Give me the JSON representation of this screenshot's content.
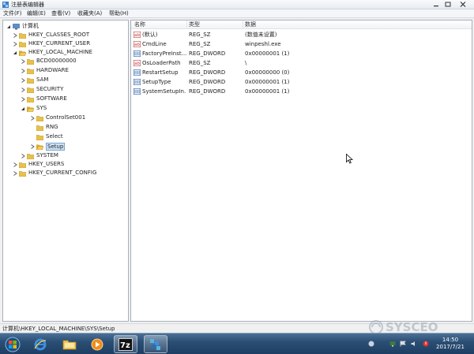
{
  "window": {
    "title": "注册表编辑器",
    "icon": "regedit-icon"
  },
  "menubar": {
    "items": [
      "文件(F)",
      "编辑(E)",
      "查看(V)",
      "收藏夹(A)",
      "帮助(H)"
    ]
  },
  "tree": {
    "root": "计算机",
    "nodes": [
      {
        "label": "HKEY_CLASSES_ROOT",
        "level": 1,
        "expanded": false
      },
      {
        "label": "HKEY_CURRENT_USER",
        "level": 1,
        "expanded": false
      },
      {
        "label": "HKEY_LOCAL_MACHINE",
        "level": 1,
        "expanded": true
      },
      {
        "label": "BCD00000000",
        "level": 2,
        "expanded": false
      },
      {
        "label": "HARDWARE",
        "level": 2,
        "expanded": false
      },
      {
        "label": "SAM",
        "level": 2,
        "expanded": false
      },
      {
        "label": "SECURITY",
        "level": 2,
        "expanded": false
      },
      {
        "label": "SOFTWARE",
        "level": 2,
        "expanded": false
      },
      {
        "label": "SYS",
        "level": 2,
        "expanded": true
      },
      {
        "label": "ControlSet001",
        "level": 3,
        "expanded": false
      },
      {
        "label": "RNG",
        "level": 3,
        "expanded": false,
        "leaf": true
      },
      {
        "label": "Select",
        "level": 3,
        "expanded": false,
        "leaf": true
      },
      {
        "label": "Setup",
        "level": 3,
        "expanded": false,
        "selected": true
      },
      {
        "label": "SYSTEM",
        "level": 2,
        "expanded": false
      },
      {
        "label": "HKEY_USERS",
        "level": 1,
        "expanded": false
      },
      {
        "label": "HKEY_CURRENT_CONFIG",
        "level": 1,
        "expanded": false
      }
    ]
  },
  "list": {
    "columns": [
      "名称",
      "类型",
      "数据"
    ],
    "rows": [
      {
        "name": "(默认)",
        "type": "REG_SZ",
        "data": "(数值未设置)",
        "icon": "string-value-icon"
      },
      {
        "name": "CmdLine",
        "type": "REG_SZ",
        "data": "winpeshl.exe",
        "icon": "string-value-icon"
      },
      {
        "name": "FactoryPreInst...",
        "type": "REG_DWORD",
        "data": "0x00000001 (1)",
        "icon": "binary-value-icon"
      },
      {
        "name": "OsLoaderPath",
        "type": "REG_SZ",
        "data": "\\",
        "icon": "string-value-icon"
      },
      {
        "name": "RestartSetup",
        "type": "REG_DWORD",
        "data": "0x00000000 (0)",
        "icon": "binary-value-icon"
      },
      {
        "name": "SetupType",
        "type": "REG_DWORD",
        "data": "0x00000001 (1)",
        "icon": "binary-value-icon"
      },
      {
        "name": "SystemSetupIn...",
        "type": "REG_DWORD",
        "data": "0x00000001 (1)",
        "icon": "binary-value-icon"
      }
    ]
  },
  "statusbar": {
    "path": "计算机\\HKEY_LOCAL_MACHINE\\SYS\\Setup"
  },
  "taskbar": {
    "apps": [
      "start-orb-icon",
      "ie-icon",
      "explorer-icon",
      "media-player-icon",
      "7zip-icon",
      "regedit-icon"
    ],
    "zip_label": "7z",
    "clock_time": "14:50",
    "clock_date": "2017/7/21"
  },
  "watermark": "SYSCEO",
  "colors": {
    "folder": "#e8c14b",
    "selection": "#cde3f8",
    "taskbar": "#2b4e74"
  }
}
